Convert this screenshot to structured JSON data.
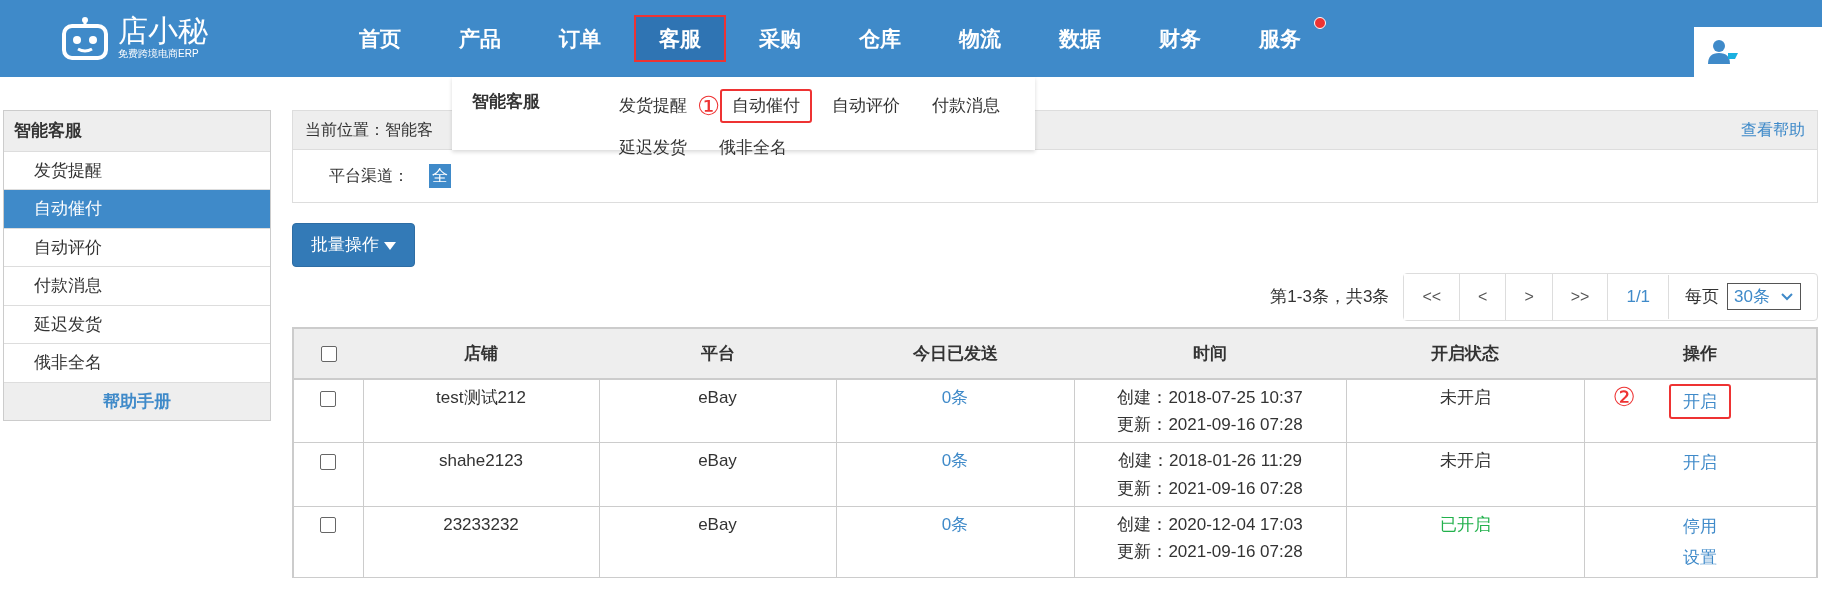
{
  "logo": {
    "name": "店小秘",
    "tagline": "免费跨境电商ERP"
  },
  "nav": [
    {
      "label": "首页",
      "selected": false,
      "highlighted": false,
      "dot": false
    },
    {
      "label": "产品",
      "selected": false,
      "highlighted": false,
      "dot": false
    },
    {
      "label": "订单",
      "selected": false,
      "highlighted": false,
      "dot": false
    },
    {
      "label": "客服",
      "selected": true,
      "highlighted": true,
      "dot": false
    },
    {
      "label": "采购",
      "selected": false,
      "highlighted": false,
      "dot": false
    },
    {
      "label": "仓库",
      "selected": false,
      "highlighted": false,
      "dot": false
    },
    {
      "label": "物流",
      "selected": false,
      "highlighted": false,
      "dot": false
    },
    {
      "label": "数据",
      "selected": false,
      "highlighted": false,
      "dot": false
    },
    {
      "label": "财务",
      "selected": false,
      "highlighted": false,
      "dot": false
    },
    {
      "label": "服务",
      "selected": false,
      "highlighted": false,
      "dot": true
    }
  ],
  "dropdown": {
    "group": "智能客服",
    "rows": [
      [
        {
          "label": "发货提醒",
          "highlighted": false,
          "marker": "①"
        },
        {
          "label": "自动催付",
          "highlighted": true
        },
        {
          "label": "自动评价",
          "highlighted": false
        },
        {
          "label": "付款消息",
          "highlighted": false
        }
      ],
      [
        {
          "label": "延迟发货",
          "highlighted": false
        },
        {
          "label": "俄非全名",
          "highlighted": false
        }
      ]
    ]
  },
  "sidebar": {
    "title": "智能客服",
    "items": [
      {
        "label": "发货提醒",
        "selected": false
      },
      {
        "label": "自动催付",
        "selected": true
      },
      {
        "label": "自动评价",
        "selected": false
      },
      {
        "label": "付款消息",
        "selected": false
      },
      {
        "label": "延迟发货",
        "selected": false
      },
      {
        "label": "俄非全名",
        "selected": false
      }
    ],
    "help": "帮助手册"
  },
  "breadcrumb": {
    "label": "当前位置：",
    "path": "智能客",
    "help": "查看帮助"
  },
  "channel": {
    "label": "平台渠道：",
    "options": [
      {
        "label": "全",
        "selected": true
      }
    ]
  },
  "batch_button": "批量操作",
  "pagination": {
    "summary": "第1-3条，共3条",
    "buttons": [
      "<<",
      "<",
      ">",
      ">>"
    ],
    "page": "1/1",
    "per_page_label": "每页",
    "per_page": "30条"
  },
  "table": {
    "select_all": false,
    "columns": [
      "店铺",
      "平台",
      "今日已发送",
      "时间",
      "开启状态",
      "操作"
    ],
    "rows": [
      {
        "checked": false,
        "shop": "test测试212",
        "platform": "eBay",
        "sent": "0条",
        "created": "创建：2018-07-25 10:37",
        "updated": "更新：2021-09-16 07:28",
        "status": "未开启",
        "enabled": false,
        "actions": [
          {
            "label": "开启",
            "highlighted": true
          }
        ],
        "marker": "②"
      },
      {
        "checked": false,
        "shop": "shahe2123",
        "platform": "eBay",
        "sent": "0条",
        "created": "创建：2018-01-26 11:29",
        "updated": "更新：2021-09-16 07:28",
        "status": "未开启",
        "enabled": false,
        "actions": [
          {
            "label": "开启",
            "highlighted": false
          }
        ]
      },
      {
        "checked": false,
        "shop": "23233232",
        "platform": "eBay",
        "sent": "0条",
        "created": "创建：2020-12-04 17:03",
        "updated": "更新：2021-09-16 07:28",
        "status": "已开启",
        "enabled": true,
        "actions": [
          {
            "label": "停用",
            "highlighted": false
          },
          {
            "label": "设置",
            "highlighted": false
          }
        ]
      }
    ]
  }
}
